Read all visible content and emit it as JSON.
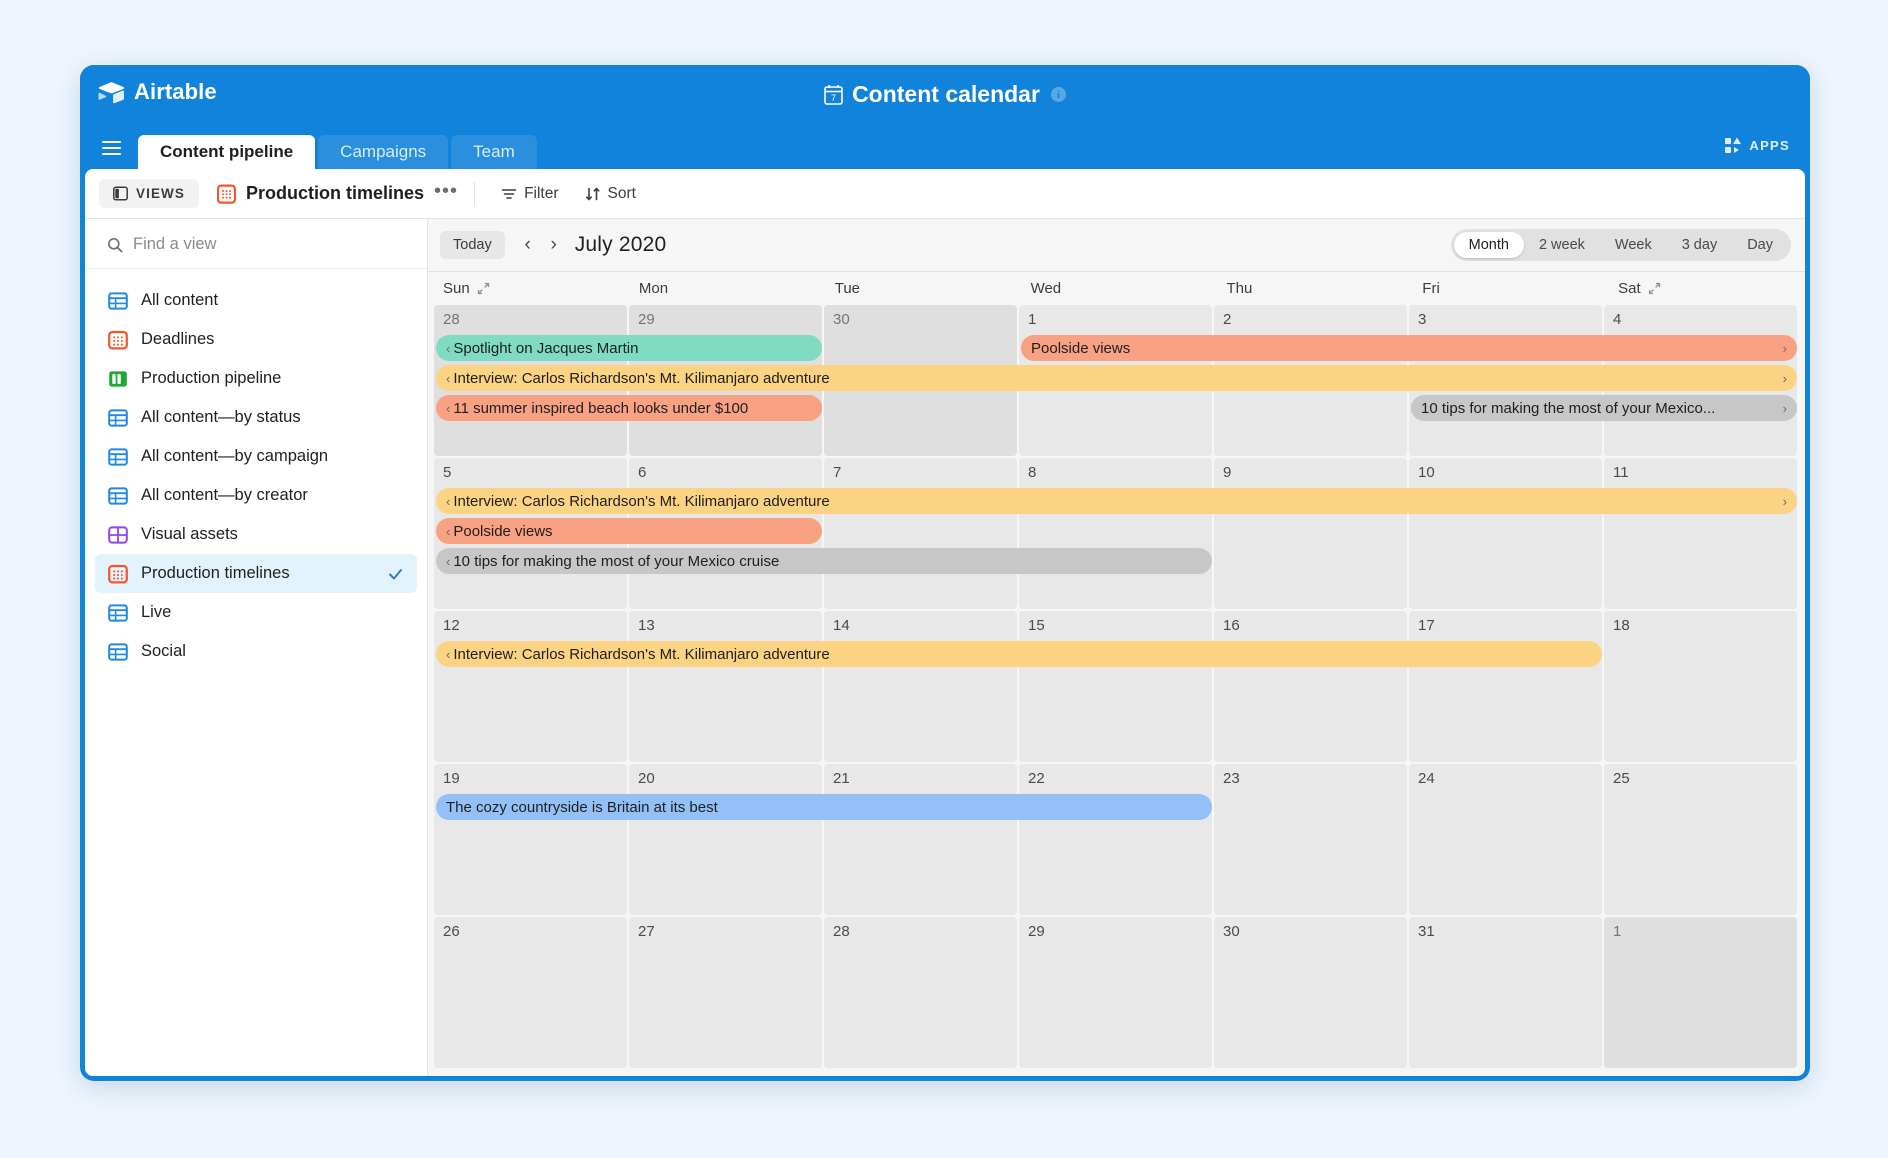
{
  "brand": {
    "name": "Airtable",
    "logo_icon": "airtable-logo-icon"
  },
  "header": {
    "title": "Content calendar",
    "title_icon": "calendar-7-icon",
    "info_icon": "info-icon",
    "apps_label": "APPS",
    "apps_icon": "apps-grid-icon",
    "menu_icon": "hamburger-menu-icon"
  },
  "tabs": [
    {
      "label": "Content pipeline",
      "active": true
    },
    {
      "label": "Campaigns",
      "active": false
    },
    {
      "label": "Team",
      "active": false
    }
  ],
  "view_bar": {
    "views_label": "VIEWS",
    "views_icon": "side-panel-icon",
    "current_view": "Production timelines",
    "current_view_icon": "calendar-view-icon",
    "more_label": "•••",
    "filter_label": "Filter",
    "filter_icon": "filter-icon",
    "sort_label": "Sort",
    "sort_icon": "sort-icon"
  },
  "sidebar": {
    "search_placeholder": "Find a view",
    "search_value": "",
    "search_icon": "search-icon",
    "items": [
      {
        "label": "All content",
        "icon": "grid-view-icon",
        "color": "#1f87e5",
        "selected": false
      },
      {
        "label": "Deadlines",
        "icon": "calendar-view-icon",
        "color": "#f4562c",
        "selected": false
      },
      {
        "label": "Production pipeline",
        "icon": "kanban-view-icon",
        "color": "#1ca832",
        "selected": false
      },
      {
        "label": "All content—by status",
        "icon": "grid-view-icon",
        "color": "#1f87e5",
        "selected": false
      },
      {
        "label": "All content—by campaign",
        "icon": "grid-view-icon",
        "color": "#1f87e5",
        "selected": false
      },
      {
        "label": "All content—by creator",
        "icon": "grid-view-icon",
        "color": "#1f87e5",
        "selected": false
      },
      {
        "label": "Visual assets",
        "icon": "gallery-view-icon",
        "color": "#8b46f0",
        "selected": false
      },
      {
        "label": "Production timelines",
        "icon": "calendar-view-icon",
        "color": "#f4562c",
        "selected": true
      },
      {
        "label": "Live",
        "icon": "grid-view-icon",
        "color": "#1f87e5",
        "selected": false
      },
      {
        "label": "Social",
        "icon": "grid-view-icon",
        "color": "#1f87e5",
        "selected": false
      }
    ]
  },
  "calendar": {
    "today_label": "Today",
    "prev_label": "‹",
    "next_label": "›",
    "month_label": "July 2020",
    "ranges": [
      {
        "label": "Month",
        "active": true
      },
      {
        "label": "2 week",
        "active": false
      },
      {
        "label": "Week",
        "active": false
      },
      {
        "label": "3 day",
        "active": false
      },
      {
        "label": "Day",
        "active": false
      }
    ],
    "day_headers": [
      {
        "label": "Sun",
        "resize": true
      },
      {
        "label": "Mon",
        "resize": false
      },
      {
        "label": "Tue",
        "resize": false
      },
      {
        "label": "Wed",
        "resize": false
      },
      {
        "label": "Thu",
        "resize": false
      },
      {
        "label": "Fri",
        "resize": false
      },
      {
        "label": "Sat",
        "resize": true
      }
    ],
    "weeks": [
      {
        "days": [
          {
            "num": "28",
            "other": true
          },
          {
            "num": "29",
            "other": true
          },
          {
            "num": "30",
            "other": true
          },
          {
            "num": "1",
            "other": false
          },
          {
            "num": "2",
            "other": false
          },
          {
            "num": "3",
            "other": false
          },
          {
            "num": "4",
            "other": false
          }
        ],
        "events": [
          {
            "title": "Spotlight on Jacques Martin",
            "start": 0,
            "span": 2,
            "row": 0,
            "color": "#7fdcc0",
            "chev_left": true,
            "chev_right": false
          },
          {
            "title": "Interview: Carlos Richardson's Mt. Kilimanjaro adventure",
            "start": 0,
            "span": 7,
            "row": 1,
            "color": "#fcd383",
            "chev_left": true,
            "chev_right": true
          },
          {
            "title": "11 summer inspired beach looks under $100",
            "start": 0,
            "span": 2,
            "row": 2,
            "color": "#f9a183",
            "chev_left": true,
            "chev_right": false
          },
          {
            "title": "Poolside views",
            "start": 3,
            "span": 4,
            "row": 0,
            "color": "#f9a183",
            "chev_left": false,
            "chev_right": true
          },
          {
            "title": "10 tips for making the most of your Mexico...",
            "start": 5,
            "span": 2,
            "row": 2,
            "color": "#c7c7c7",
            "chev_left": false,
            "chev_right": true
          }
        ]
      },
      {
        "days": [
          {
            "num": "5",
            "other": false
          },
          {
            "num": "6",
            "other": false
          },
          {
            "num": "7",
            "other": false
          },
          {
            "num": "8",
            "other": false
          },
          {
            "num": "9",
            "other": false
          },
          {
            "num": "10",
            "other": false
          },
          {
            "num": "11",
            "other": false
          }
        ],
        "events": [
          {
            "title": "Interview: Carlos Richardson's Mt. Kilimanjaro adventure",
            "start": 0,
            "span": 7,
            "row": 0,
            "color": "#fcd383",
            "chev_left": true,
            "chev_right": true
          },
          {
            "title": "Poolside views",
            "start": 0,
            "span": 2,
            "row": 1,
            "color": "#f9a183",
            "chev_left": true,
            "chev_right": false
          },
          {
            "title": "10 tips for making the most of your Mexico cruise",
            "start": 0,
            "span": 4,
            "row": 2,
            "color": "#c7c7c7",
            "chev_left": true,
            "chev_right": false
          }
        ]
      },
      {
        "days": [
          {
            "num": "12",
            "other": false
          },
          {
            "num": "13",
            "other": false
          },
          {
            "num": "14",
            "other": false
          },
          {
            "num": "15",
            "other": false
          },
          {
            "num": "16",
            "other": false
          },
          {
            "num": "17",
            "other": false
          },
          {
            "num": "18",
            "other": false
          }
        ],
        "events": [
          {
            "title": "Interview: Carlos Richardson's Mt. Kilimanjaro adventure",
            "start": 0,
            "span": 6,
            "row": 0,
            "color": "#fcd383",
            "chev_left": true,
            "chev_right": false
          }
        ]
      },
      {
        "days": [
          {
            "num": "19",
            "other": false
          },
          {
            "num": "20",
            "other": false
          },
          {
            "num": "21",
            "other": false
          },
          {
            "num": "22",
            "other": false
          },
          {
            "num": "23",
            "other": false
          },
          {
            "num": "24",
            "other": false
          },
          {
            "num": "25",
            "other": false
          }
        ],
        "events": [
          {
            "title": "The cozy countryside is Britain at its best",
            "start": 0,
            "span": 4,
            "row": 0,
            "color": "#93c1f7",
            "chev_left": false,
            "chev_right": false
          }
        ]
      },
      {
        "days": [
          {
            "num": "26",
            "other": false
          },
          {
            "num": "27",
            "other": false
          },
          {
            "num": "28",
            "other": false
          },
          {
            "num": "29",
            "other": false
          },
          {
            "num": "30",
            "other": false
          },
          {
            "num": "31",
            "other": false
          },
          {
            "num": "1",
            "other": true
          }
        ],
        "events": []
      }
    ]
  },
  "colors": {
    "brand_blue": "#1283da",
    "selected_view_bg": "#e3f3fc",
    "accent_orange": "#f4562c"
  }
}
